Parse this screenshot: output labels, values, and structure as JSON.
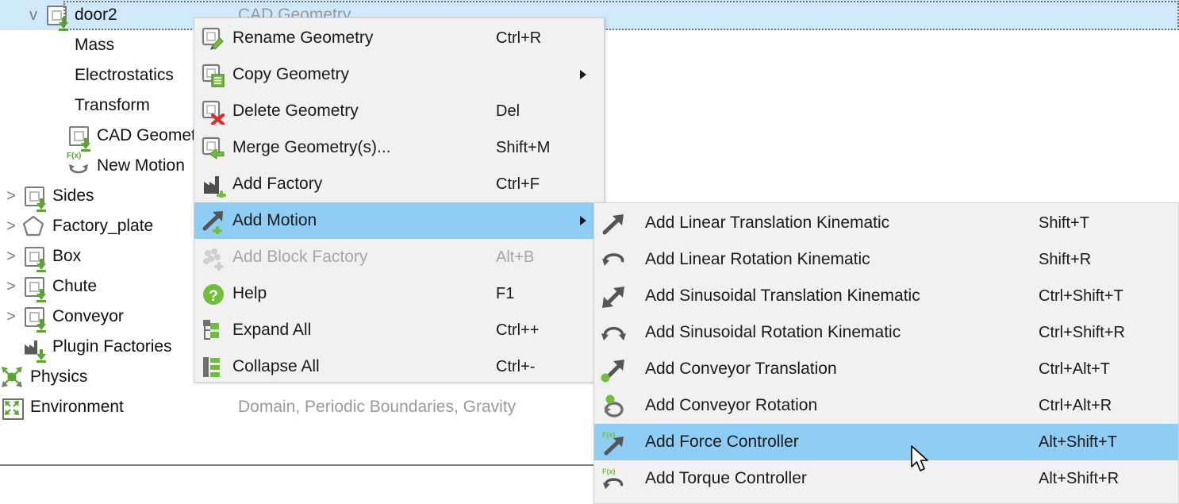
{
  "tree": {
    "rows": [
      {
        "label": "door2",
        "twisty": "v",
        "icon": "geometry-icon",
        "indent": 56,
        "selected": true,
        "sub": "CAD Geometry"
      },
      {
        "label": "Mass",
        "twisty": "",
        "icon": "none",
        "indent": 84,
        "selected": false,
        "sub": ""
      },
      {
        "label": "Electrostatics",
        "twisty": "",
        "icon": "none",
        "indent": 84,
        "selected": false,
        "sub": ""
      },
      {
        "label": "Transform",
        "twisty": "",
        "icon": "none",
        "indent": 84,
        "selected": false,
        "sub": ""
      },
      {
        "label": "CAD Geometry",
        "twisty": "",
        "icon": "geometry-icon",
        "indent": 84,
        "selected": false,
        "sub": ""
      },
      {
        "label": "New Motion",
        "twisty": "",
        "icon": "motion-icon",
        "indent": 84,
        "selected": false,
        "sub": ""
      },
      {
        "label": "Sides",
        "twisty": ">",
        "icon": "geometry-icon",
        "indent": 28,
        "selected": false,
        "sub": ""
      },
      {
        "label": "Factory_plate",
        "twisty": ">",
        "icon": "pentagon-icon",
        "indent": 28,
        "selected": false,
        "sub": ""
      },
      {
        "label": "Box",
        "twisty": ">",
        "icon": "geometry-icon",
        "indent": 28,
        "selected": false,
        "sub": ""
      },
      {
        "label": "Chute",
        "twisty": ">",
        "icon": "geometry-icon",
        "indent": 28,
        "selected": false,
        "sub": ""
      },
      {
        "label": "Conveyor",
        "twisty": ">",
        "icon": "geometry-icon",
        "indent": 28,
        "selected": false,
        "sub": ""
      },
      {
        "label": "Plugin Factories",
        "twisty": "",
        "icon": "factory-icon",
        "indent": 28,
        "selected": false,
        "sub": ""
      },
      {
        "label": "Physics",
        "twisty": "",
        "icon": "physics-icon",
        "indent": 0,
        "selected": false,
        "sub": ""
      },
      {
        "label": "Environment",
        "twisty": "",
        "icon": "environment-icon",
        "indent": 0,
        "selected": false,
        "sub": "Domain, Periodic Boundaries, Gravity"
      }
    ]
  },
  "context_menu": {
    "items": [
      {
        "label": "Rename Geometry",
        "shortcut": "Ctrl+R",
        "icon": "rename-geometry-icon",
        "highlighted": false,
        "disabled": false,
        "submenu": false
      },
      {
        "label": "Copy Geometry",
        "shortcut": "",
        "icon": "copy-geometry-icon",
        "highlighted": false,
        "disabled": false,
        "submenu": true
      },
      {
        "label": "Delete Geometry",
        "shortcut": "Del",
        "icon": "delete-geometry-icon",
        "highlighted": false,
        "disabled": false,
        "submenu": false
      },
      {
        "label": "Merge Geometry(s)...",
        "shortcut": "Shift+M",
        "icon": "merge-geometry-icon",
        "highlighted": false,
        "disabled": false,
        "submenu": false
      },
      {
        "label": "Add Factory",
        "shortcut": "Ctrl+F",
        "icon": "add-factory-icon",
        "highlighted": false,
        "disabled": false,
        "submenu": false
      },
      {
        "label": "Add Motion",
        "shortcut": "",
        "icon": "add-motion-icon",
        "highlighted": true,
        "disabled": false,
        "submenu": true
      },
      {
        "label": "Add Block Factory",
        "shortcut": "Alt+B",
        "icon": "add-block-factory-icon",
        "highlighted": false,
        "disabled": true,
        "submenu": false
      },
      {
        "label": "Help",
        "shortcut": "F1",
        "icon": "help-icon",
        "highlighted": false,
        "disabled": false,
        "submenu": false
      },
      {
        "label": "Expand All",
        "shortcut": "Ctrl++",
        "icon": "expand-all-icon",
        "highlighted": false,
        "disabled": false,
        "submenu": false
      },
      {
        "label": "Collapse All",
        "shortcut": "Ctrl+-",
        "icon": "collapse-all-icon",
        "highlighted": false,
        "disabled": false,
        "submenu": false
      }
    ]
  },
  "submenu": {
    "items": [
      {
        "label": "Add Linear Translation Kinematic",
        "shortcut": "Shift+T",
        "icon": "linear-translation-icon",
        "highlighted": false
      },
      {
        "label": "Add Linear Rotation Kinematic",
        "shortcut": "Shift+R",
        "icon": "linear-rotation-icon",
        "highlighted": false
      },
      {
        "label": "Add Sinusoidal Translation Kinematic",
        "shortcut": "Ctrl+Shift+T",
        "icon": "sinusoidal-translation-icon",
        "highlighted": false
      },
      {
        "label": "Add Sinusoidal Rotation Kinematic",
        "shortcut": "Ctrl+Shift+R",
        "icon": "sinusoidal-rotation-icon",
        "highlighted": false
      },
      {
        "label": "Add Conveyor Translation",
        "shortcut": "Ctrl+Alt+T",
        "icon": "conveyor-translation-icon",
        "highlighted": false
      },
      {
        "label": "Add Conveyor Rotation",
        "shortcut": "Ctrl+Alt+R",
        "icon": "conveyor-rotation-icon",
        "highlighted": false
      },
      {
        "label": "Add Force Controller",
        "shortcut": "Alt+Shift+T",
        "icon": "force-controller-icon",
        "highlighted": true
      },
      {
        "label": "Add Torque Controller",
        "shortcut": "Alt+Shift+R",
        "icon": "torque-controller-icon",
        "highlighted": false
      }
    ]
  },
  "colors": {
    "menu_bg": "#f1f1f1",
    "highlight": "#8ecdf4",
    "tree_selection": "#cfe8fa",
    "accent_green": "#5aa62f",
    "disabled_text": "#a6a6a6",
    "subtext": "#9a9a9a"
  }
}
